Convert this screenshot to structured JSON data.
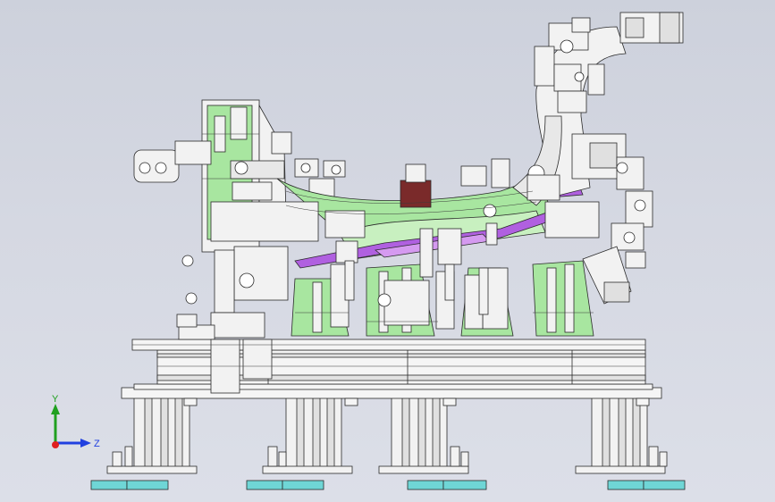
{
  "viewport": {
    "background": "#d5d8e2",
    "model_colors": {
      "frame": "#f4f4f4",
      "edge": "#2a2a2a",
      "green_part": "#a8e6a0",
      "purple_part": "#b060e0",
      "cyan_pad": "#6fd6d6",
      "dark_red": "#7a2a2a"
    }
  },
  "triad": {
    "y_label": "Y",
    "z_label": "Z",
    "y_color": "#20a020",
    "z_color": "#2040e0",
    "x_color": "#e02020"
  }
}
